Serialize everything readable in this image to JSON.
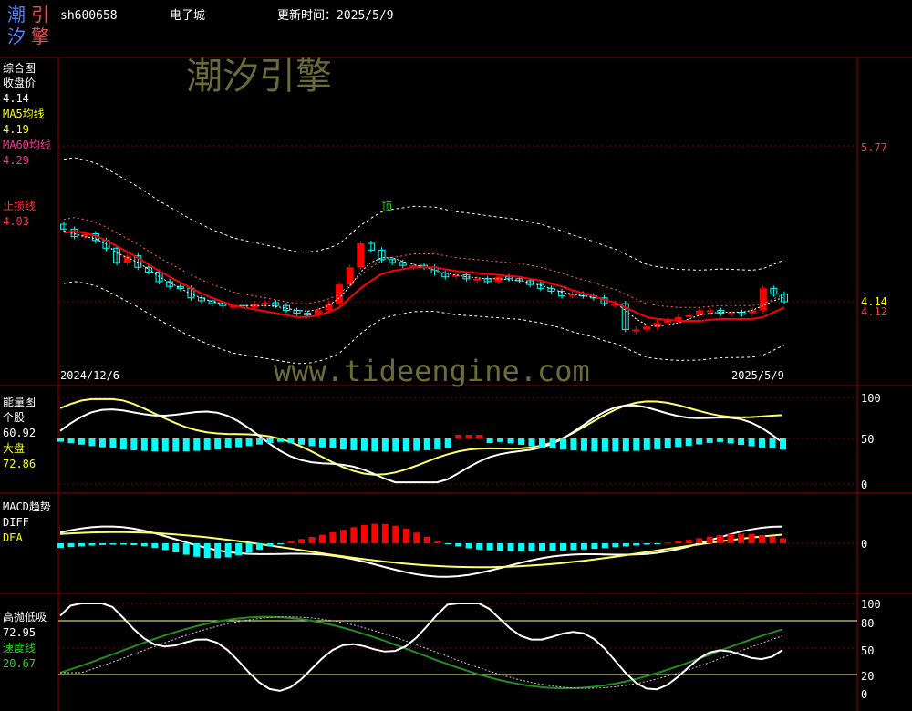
{
  "header": {
    "logo_chars": [
      "潮",
      "引",
      "汐",
      "擎"
    ],
    "symbol": "sh600658",
    "name": "电子城",
    "update_label": "更新时间：2025/5/9"
  },
  "watermark": {
    "brand": "潮汐引擎",
    "url": "www.tideengine.com"
  },
  "colors": {
    "bg": "#000000",
    "grid": "#8b0000",
    "up": "#ff0000",
    "down": "#00ffff",
    "ma5": "#ffffff",
    "ma60": "#ff0000",
    "band": "#ffffff",
    "yellow": "#ffff66",
    "green": "#228b22"
  },
  "panels": {
    "main": {
      "title": "综合图",
      "close_label": "收盘价",
      "close_value": "4.14",
      "ma5_label": "MA5均线",
      "ma5_value": "4.19",
      "ma60_label": "MA60均线",
      "ma60_value": "4.29",
      "stop_label": "止损线",
      "stop_value": "4.03",
      "date_start": "2024/12/6",
      "date_end": "2025/5/9",
      "marker": "顶",
      "axis": [
        "5.77",
        "4.14",
        "4.12"
      ]
    },
    "energy": {
      "title": "能量图",
      "stock_label": "个股",
      "stock_value": "60.92",
      "market_label": "大盘",
      "market_value": "72.86",
      "axis": [
        "100",
        "50",
        "0"
      ]
    },
    "macd": {
      "title": "MACD趋势",
      "diff_label": "DIFF",
      "dea_label": "DEA",
      "axis": [
        "0"
      ]
    },
    "hl": {
      "title": "高抛低吸",
      "value1": "72.95",
      "speed_label": "速度线",
      "value2": "20.67",
      "axis": [
        "100",
        "80",
        "50",
        "20",
        "0"
      ]
    }
  },
  "chart_data": [
    {
      "type": "candlestick",
      "title": "综合图",
      "x": [
        "2024/12/6",
        "2025/5/9"
      ],
      "close": [
        4.9,
        4.82,
        4.85,
        4.78,
        4.7,
        4.55,
        4.62,
        4.5,
        4.45,
        4.35,
        4.3,
        4.28,
        4.18,
        4.15,
        4.12,
        4.1,
        4.1,
        4.08,
        4.12,
        4.13,
        4.1,
        4.05,
        4.02,
        4.0,
        4.05,
        4.12,
        4.32,
        4.5,
        4.75,
        4.68,
        4.58,
        4.55,
        4.52,
        4.52,
        4.5,
        4.44,
        4.4,
        4.42,
        4.38,
        4.38,
        4.35,
        4.4,
        4.38,
        4.36,
        4.32,
        4.28,
        4.25,
        4.2,
        4.22,
        4.2,
        4.18,
        4.12,
        4.12,
        3.85,
        3.85,
        3.88,
        3.92,
        3.95,
        3.98,
        4.0,
        4.05,
        4.05,
        4.02,
        4.03,
        4.02,
        4.05,
        4.28,
        4.22,
        4.14
      ],
      "ma5": [
        4.88,
        4.85,
        4.82,
        4.8,
        4.74,
        4.65,
        4.6,
        4.55,
        4.48,
        4.4,
        4.34,
        4.28,
        4.22,
        4.18,
        4.14,
        4.12,
        4.1,
        4.1,
        4.1,
        4.1,
        4.09,
        4.07,
        4.05,
        4.04,
        4.06,
        4.1,
        4.18,
        4.3,
        4.45,
        4.55,
        4.6,
        4.6,
        4.56,
        4.53,
        4.5,
        4.47,
        4.44,
        4.42,
        4.4,
        4.39,
        4.38,
        4.38,
        4.37,
        4.36,
        4.34,
        4.31,
        4.28,
        4.24,
        4.22,
        4.2,
        4.19,
        4.16,
        4.13,
        4.05,
        3.96,
        3.9,
        3.88,
        3.9,
        3.92,
        3.96,
        4.0,
        4.02,
        4.03,
        4.03,
        4.03,
        4.05,
        4.1,
        4.15,
        4.19
      ],
      "ma60": [
        4.88,
        4.9,
        4.88,
        4.85,
        4.8,
        4.74,
        4.68,
        4.62,
        4.55,
        4.48,
        4.42,
        4.36,
        4.3,
        4.25,
        4.2,
        4.16,
        4.12,
        4.1,
        4.08,
        4.06,
        4.04,
        4.02,
        4.0,
        4.0,
        4.02,
        4.05,
        4.1,
        4.2,
        4.3,
        4.38,
        4.45,
        4.48,
        4.5,
        4.52,
        4.52,
        4.52,
        4.5,
        4.48,
        4.47,
        4.46,
        4.45,
        4.44,
        4.43,
        4.42,
        4.4,
        4.38,
        4.35,
        4.32,
        4.28,
        4.25,
        4.22,
        4.18,
        4.15,
        4.1,
        4.05,
        4.0,
        3.98,
        3.97,
        3.96,
        3.96,
        3.96,
        3.97,
        3.98,
        3.98,
        3.98,
        3.98,
        4.0,
        4.05,
        4.1
      ],
      "ylevels": [
        5.77,
        4.14,
        4.12
      ]
    },
    {
      "type": "line",
      "title": "能量图",
      "ylim": [
        0,
        100
      ]
    },
    {
      "type": "bar",
      "title": "MACD趋势"
    },
    {
      "type": "line",
      "title": "高抛低吸",
      "ylim": [
        0,
        100
      ],
      "levels": [
        80,
        50,
        20
      ]
    }
  ]
}
